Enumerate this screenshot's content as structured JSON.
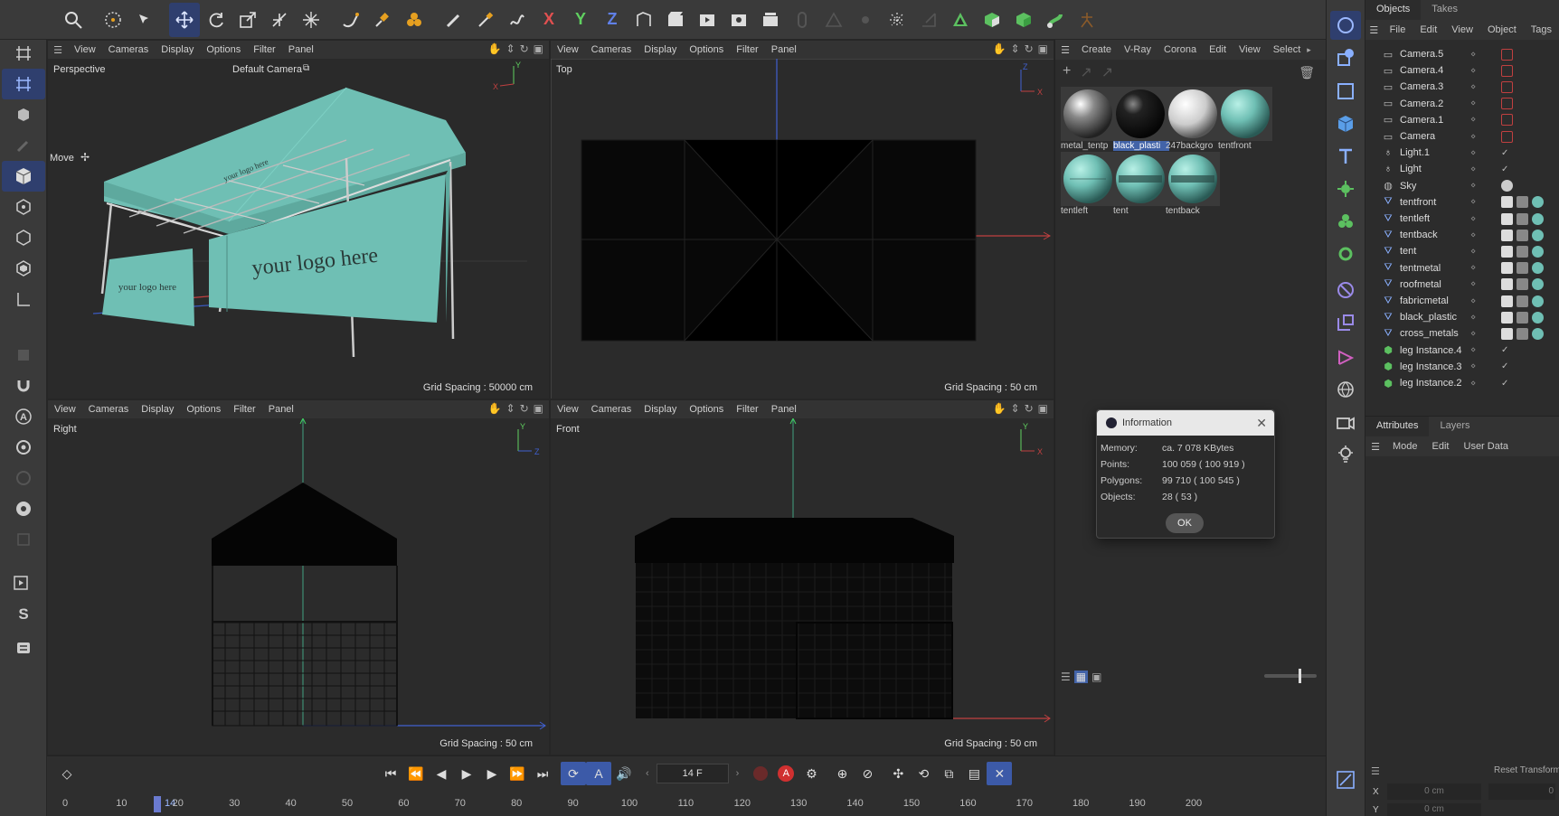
{
  "colors": {
    "accent": "#2f3f6e",
    "selection": "#4263a8",
    "tent_teal": "#6fbfb4"
  },
  "toolbar": {
    "icons": [
      "search-icon",
      "live-select-icon",
      "selection-filter-icon",
      "move-icon",
      "rotate-icon",
      "scale-icon",
      "axis-move-icon",
      "snap-icon",
      "spline-pen-icon",
      "spline-eraser-icon",
      "effector-icon",
      "brush-icon",
      "knife-icon",
      "bevel-icon",
      "x-axis-lock",
      "y-axis-lock",
      "z-axis-lock",
      "world-coord-icon",
      "render-view-icon",
      "render-picture-viewer-icon",
      "edit-render-settings-icon",
      "render-queue-icon",
      "link-icon",
      "triangle-icon",
      "gear-small-icon",
      "particles-icon",
      "arrow-export-icon",
      "vray-icon",
      "cube-material-icon",
      "green-cube-icon",
      "green-link-icon",
      "figure-icon"
    ],
    "axis_x": "X",
    "axis_y": "Y",
    "axis_z": "Z"
  },
  "leftbar": {
    "icons": [
      "settings-icon",
      "grid-icon",
      "polygon-pen-icon",
      "tweak-icon",
      "object-mode-icon",
      "points-mode-icon",
      "edges-mode-icon",
      "polygons-mode-icon",
      "uv-mode-icon",
      "axis-mode-icon",
      "solo-icon",
      "magnet-icon",
      "text-a-icon",
      "workplane-icon",
      "gear-ring-icon",
      "eye-icon",
      "timeline-clip-icon",
      "render-region-icon",
      "s-icon",
      "layer-icon"
    ],
    "move_label": "Move"
  },
  "viewports": {
    "menu": [
      "View",
      "Cameras",
      "Display",
      "Options",
      "Filter",
      "Panel"
    ],
    "perspective": {
      "name": "Perspective",
      "camera": "Default Camera",
      "grid": "Grid Spacing : 50000 cm",
      "logo_big": "your logo here",
      "logo_small": "your logo here",
      "roof_text": "your logo here"
    },
    "top": {
      "name": "Top",
      "grid": "Grid Spacing : 50 cm"
    },
    "right": {
      "name": "Right",
      "grid": "Grid Spacing : 50 cm"
    },
    "front": {
      "name": "Front",
      "grid": "Grid Spacing : 50 cm"
    }
  },
  "material_manager": {
    "menu": [
      "Create",
      "V-Ray",
      "Corona",
      "Edit",
      "View",
      "Select"
    ],
    "materials": [
      {
        "label": "metal_tentp",
        "style": "metal"
      },
      {
        "label": "black_plasti",
        "style": "black",
        "selected": true
      },
      {
        "label": "247backgro",
        "style": "white"
      },
      {
        "label": "tentfront",
        "style": "teal"
      },
      {
        "label": "tentleft",
        "style": "teal-lines"
      },
      {
        "label": "tent",
        "style": "teal-band"
      },
      {
        "label": "tentback",
        "style": "teal-band"
      }
    ]
  },
  "info_dialog": {
    "title": "Information",
    "memory_label": "Memory:",
    "memory": "ca. 7 078 KBytes",
    "points_label": "Points:",
    "points": "100 059 ( 100 919 )",
    "polygons_label": "Polygons:",
    "polygons": "99 710 ( 100 545 )",
    "objects_label": "Objects:",
    "objects": "28 ( 53 )",
    "ok": "OK"
  },
  "object_manager": {
    "tabs": [
      "Objects",
      "Takes"
    ],
    "menu": [
      "File",
      "Edit",
      "View",
      "Object",
      "Tags"
    ],
    "objects": [
      {
        "name": "Camera.5",
        "type": "camera"
      },
      {
        "name": "Camera.4",
        "type": "camera"
      },
      {
        "name": "Camera.3",
        "type": "camera"
      },
      {
        "name": "Camera.2",
        "type": "camera"
      },
      {
        "name": "Camera.1",
        "type": "camera"
      },
      {
        "name": "Camera",
        "type": "camera"
      },
      {
        "name": "Light.1",
        "type": "light"
      },
      {
        "name": "Light",
        "type": "light"
      },
      {
        "name": "Sky",
        "type": "sky"
      },
      {
        "name": "tentfront",
        "type": "mesh"
      },
      {
        "name": "tentleft",
        "type": "mesh"
      },
      {
        "name": "tentback",
        "type": "mesh"
      },
      {
        "name": "tent",
        "type": "mesh"
      },
      {
        "name": "tentmetal",
        "type": "mesh"
      },
      {
        "name": "roofmetal",
        "type": "mesh"
      },
      {
        "name": "fabricmetal",
        "type": "mesh"
      },
      {
        "name": "black_plastic",
        "type": "mesh"
      },
      {
        "name": "cross_metals",
        "type": "mesh"
      },
      {
        "name": "leg Instance.4",
        "type": "instance"
      },
      {
        "name": "leg Instance.3",
        "type": "instance"
      },
      {
        "name": "leg Instance.2",
        "type": "instance"
      }
    ]
  },
  "attributes": {
    "tabs": [
      "Attributes",
      "Layers"
    ],
    "menu": [
      "Mode",
      "Edit",
      "User Data"
    ],
    "reset": "Reset Transform",
    "x_label": "X",
    "x_value": "0 cm",
    "x_value2": "0",
    "y_label": "Y",
    "y_value": "0 cm"
  },
  "timeline": {
    "frame": "14 F",
    "current_frame": "14",
    "ticks": [
      "0",
      "10",
      "20",
      "30",
      "40",
      "50",
      "60",
      "70",
      "80",
      "90",
      "100",
      "110",
      "120",
      "130",
      "140",
      "150",
      "160",
      "170",
      "180",
      "190",
      "200"
    ]
  }
}
